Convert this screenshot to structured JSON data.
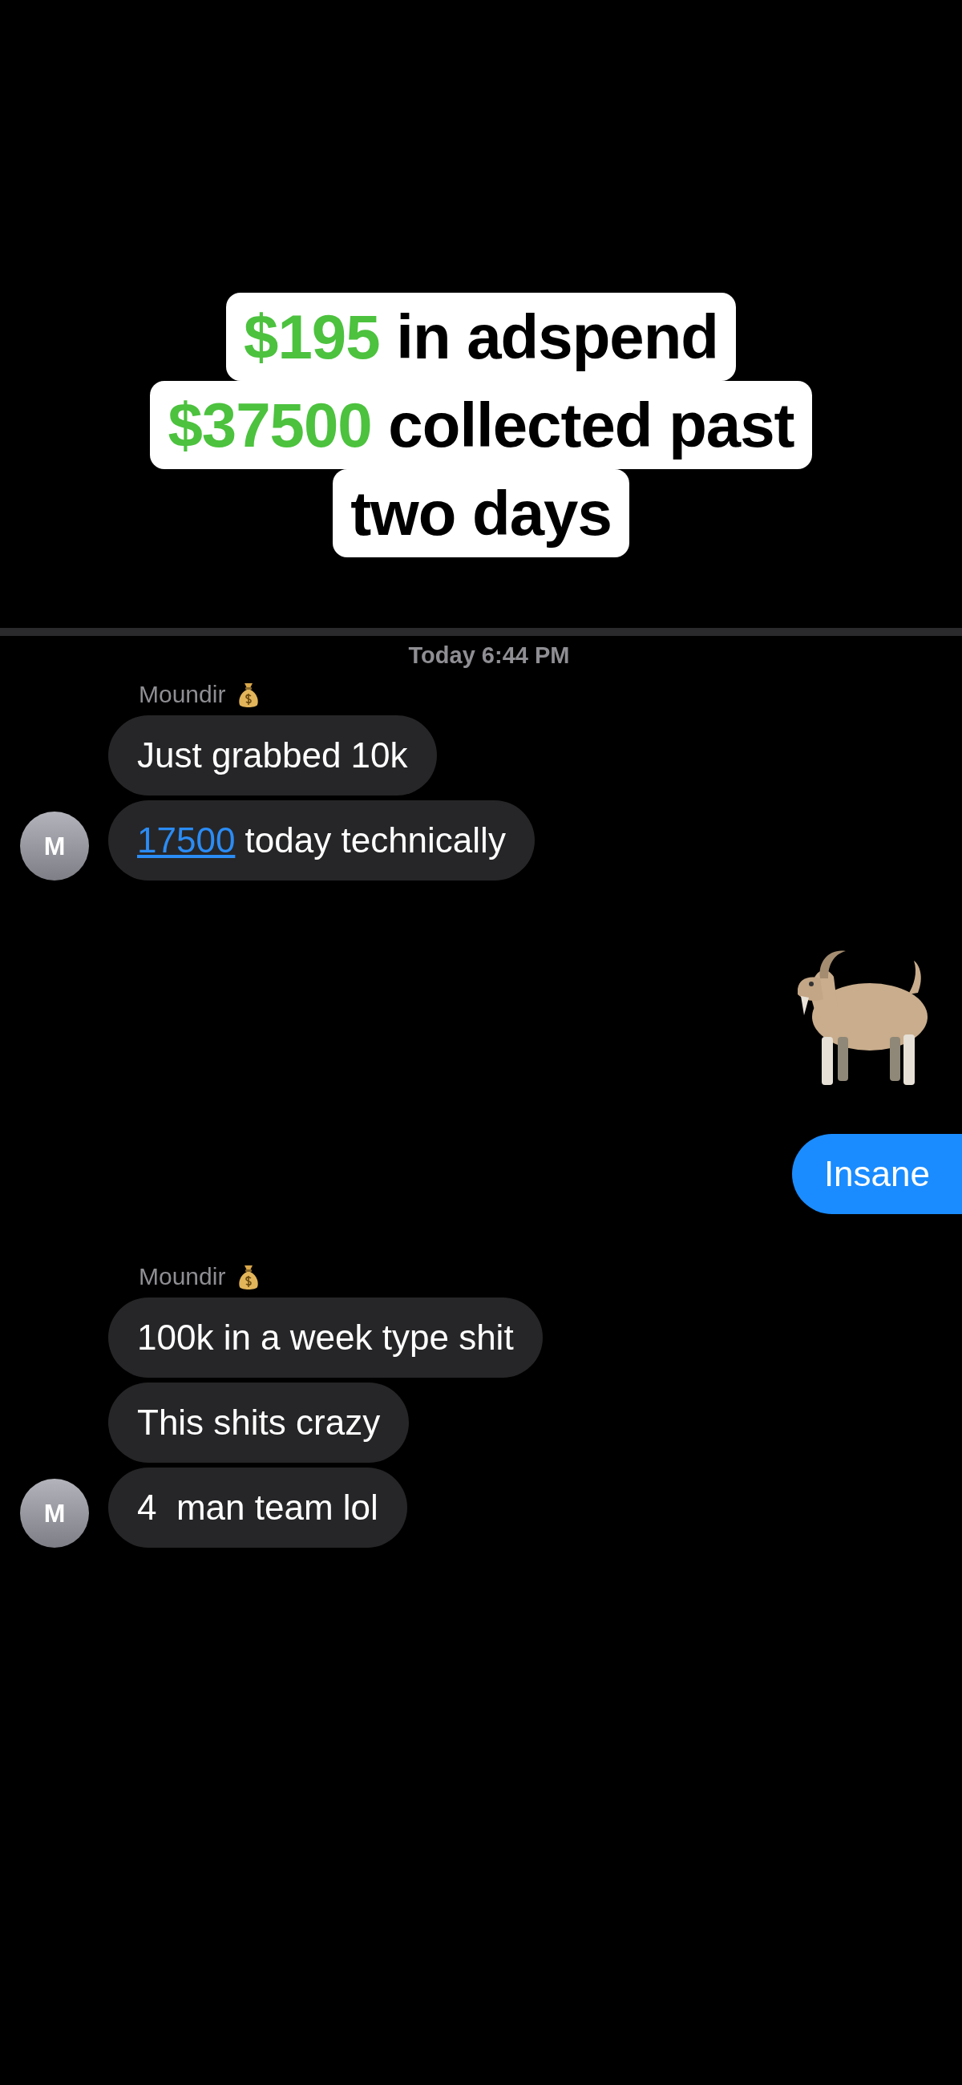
{
  "caption": {
    "lines": [
      {
        "highlight": "$195",
        "text": " in adspend"
      },
      {
        "highlight": "$37500",
        "text": " collected past"
      },
      {
        "text": "two days"
      }
    ]
  },
  "conversation": {
    "timestamp": "Today 6:44 PM",
    "groups": [
      {
        "outgoing": false,
        "sender": "Moundir",
        "avatar": "M",
        "messages": [
          {
            "kind": "text",
            "text": "Just grabbed 10k"
          },
          {
            "kind": "text",
            "link": "17500",
            "text": " today technically"
          }
        ]
      },
      {
        "outgoing": true,
        "messages": [
          {
            "kind": "goat"
          },
          {
            "kind": "text",
            "text": "Insane"
          }
        ]
      },
      {
        "outgoing": false,
        "sender": "Moundir",
        "avatar": "M",
        "messages": [
          {
            "kind": "text",
            "text": "100k in a week type shit"
          },
          {
            "kind": "text",
            "text": "This shits crazy"
          },
          {
            "kind": "text",
            "text": "4  man team lol"
          }
        ]
      }
    ]
  }
}
